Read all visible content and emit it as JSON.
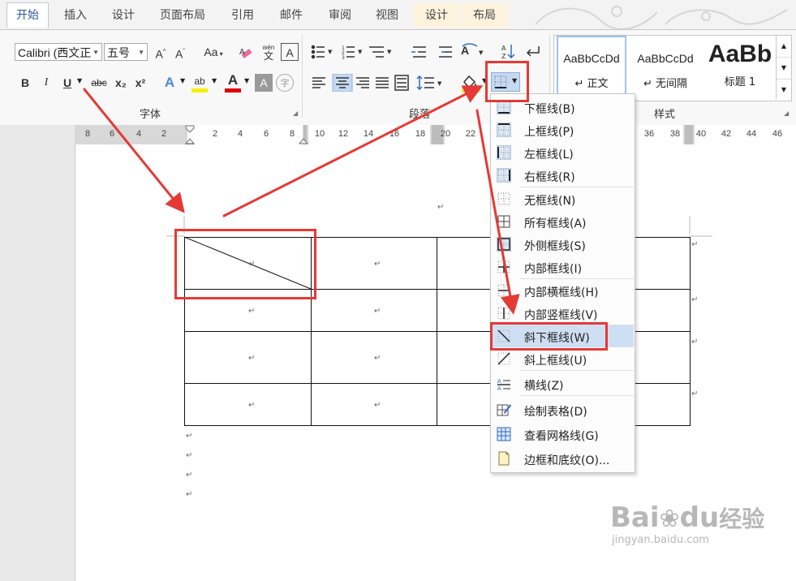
{
  "tabs": [
    {
      "label": "开始",
      "active": true
    },
    {
      "label": "插入"
    },
    {
      "label": "设计"
    },
    {
      "label": "页面布局"
    },
    {
      "label": "引用"
    },
    {
      "label": "邮件"
    },
    {
      "label": "审阅"
    },
    {
      "label": "视图"
    },
    {
      "label": "设计",
      "contextual": true
    },
    {
      "label": "布局",
      "contextual": true
    }
  ],
  "font": {
    "name_value": "Calibri (西文正",
    "size_value": "五号",
    "grow_label": "A",
    "shrink_label": "A",
    "case_label": "Aa",
    "bold": "B",
    "italic": "I",
    "underline": "U",
    "strike": "abc",
    "sub": "x₂",
    "sup": "x²",
    "phonetic_top": "wén",
    "phonetic_bottom": "文",
    "border_char": "A",
    "effects": "A",
    "highlight_label": "ab",
    "font_color": "A",
    "shade_char": "A",
    "enclose_char": "字"
  },
  "groups": {
    "font": "字体",
    "paragraph": "段落",
    "styles": "样式"
  },
  "styles": [
    {
      "preview": "AaBbCcDd",
      "name": "↵ 正文"
    },
    {
      "preview": "AaBbCcDd",
      "name": "↵ 无间隔"
    },
    {
      "preview": "AaBb",
      "name": "标题 1"
    }
  ],
  "ruler": {
    "left": [
      "8",
      "6",
      "4",
      "2",
      "2",
      "4",
      "6",
      "8",
      "10",
      "12",
      "14",
      "16",
      "18",
      "20",
      "22"
    ],
    "right": [
      "36",
      "38",
      "40",
      "42",
      "44",
      "46"
    ]
  },
  "menu": {
    "items": [
      {
        "label": "下框线(B)",
        "icon": "border-bottom-icon"
      },
      {
        "label": "上框线(P)",
        "icon": "border-top-icon"
      },
      {
        "label": "左框线(L)",
        "icon": "border-left-icon"
      },
      {
        "label": "右框线(R)",
        "icon": "border-right-icon"
      },
      {
        "label": "无框线(N)",
        "icon": "border-none-icon"
      },
      {
        "label": "所有框线(A)",
        "icon": "border-all-icon"
      },
      {
        "label": "外侧框线(S)",
        "icon": "border-outside-icon"
      },
      {
        "label": "内部框线(I)",
        "icon": "border-inside-icon"
      },
      {
        "label": "内部横框线(H)",
        "icon": "border-inside-horizontal-icon"
      },
      {
        "label": "内部竖框线(V)",
        "icon": "border-inside-vertical-icon"
      },
      {
        "label": "斜下框线(W)",
        "icon": "border-diagonal-down-icon",
        "highlighted": true
      },
      {
        "label": "斜上框线(U)",
        "icon": "border-diagonal-up-icon"
      },
      {
        "label": "横线(Z)",
        "icon": "horizontal-line-icon"
      },
      {
        "label": "绘制表格(D)",
        "icon": "draw-table-icon"
      },
      {
        "label": "查看网格线(G)",
        "icon": "view-gridlines-icon"
      },
      {
        "label": "边框和底纹(O)...",
        "icon": "borders-shading-icon"
      }
    ]
  },
  "document": {
    "para_mark": "↵",
    "cell_mark": "↵"
  },
  "watermark": {
    "brand": "Bai",
    "brand2": "du",
    "cn": "经验",
    "url": "jingyan.baidu.com"
  },
  "colors": {
    "accent": "#2b579a",
    "annotation_red": "#e53935",
    "highlight": "#cfdff3",
    "contextual_tab": "#fdf3dc"
  }
}
